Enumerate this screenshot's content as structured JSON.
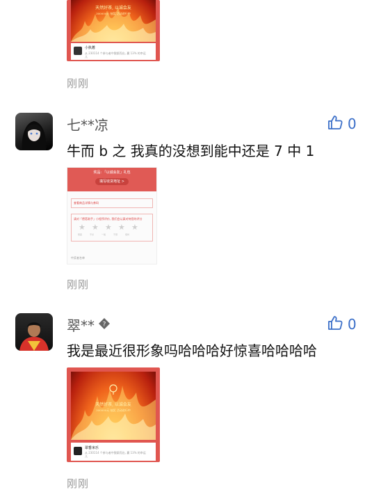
{
  "top_card": {
    "headline": "天然好茶, 以诚会友",
    "subline": "300000元 抽奖 活动进行中",
    "caption_name": "小执着",
    "caption_text": "从 230114 个参与者中脱颖而出, 赢 13% 的幸运儿"
  },
  "comments": [
    {
      "time": "刚刚"
    },
    {
      "username": "七**凉",
      "likes": "0",
      "text": "牛而 b 之 我真的没想到能中还是 7 中 1",
      "receipt": {
        "header": "奖品: 「以诚会友」礼包",
        "button": "填写收货地址 >",
        "row": "查看商品详情与券码",
        "question": "请对「德茗助手」小程序评价, 我们会认真对待您的评分",
        "star_labels": [
          "很差",
          "不好",
          "一般",
          "不错",
          "很棒"
        ],
        "footer": "中奖者名单"
      },
      "time": "刚刚"
    },
    {
      "username": "翠**",
      "likes": "0",
      "text": "我是最近很形象吗哈哈哈好惊喜哈哈哈哈",
      "card": {
        "headline": "天然好茶, 以诚会友",
        "subline": "300000元 抽奖 活动进行中",
        "caption_name": "翠香米乐",
        "caption_text": "从 230114 个参与者中脱颖而出, 赢 13% 的幸运儿"
      },
      "time": "刚刚"
    }
  ],
  "colors": {
    "accent": "#3a6ec8",
    "card_red": "#e05650"
  }
}
